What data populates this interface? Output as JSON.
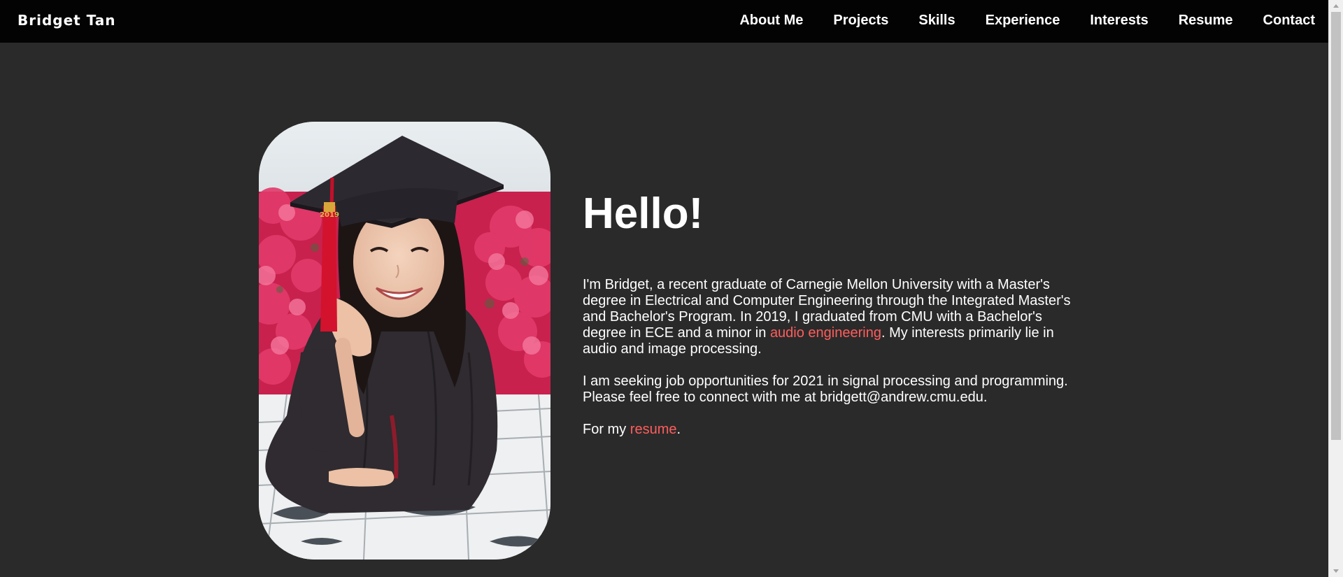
{
  "nav": {
    "brand": "Bridget Tan",
    "links": [
      "About Me",
      "Projects",
      "Skills",
      "Experience",
      "Interests",
      "Resume",
      "Contact"
    ]
  },
  "hero": {
    "heading": "Hello!",
    "intro_part1": "I'm Bridget, a recent graduate of Carnegie Mellon University with a Master's degree in Electrical and Computer Engineering through the Integrated Master's and Bachelor's Program. In 2019, I graduated from CMU with a Bachelor's degree in ECE and a minor in ",
    "intro_link": "audio engineering",
    "intro_part2": ". My interests primarily lie in audio and image processing.",
    "seeking": "I am seeking job opportunities for 2021 in signal processing and programming. Please feel free to connect with me at bridgett@andrew.cmu.edu.",
    "resume_prefix": "For my ",
    "resume_link": "resume",
    "resume_suffix": ".",
    "photo_cap_text": "2019"
  },
  "colors": {
    "background": "#2a2a2a",
    "navbar": "#030303",
    "accent": "#ff5d5d",
    "text": "#ffffff"
  },
  "icons": {
    "scroll_up": "triangle-up-icon",
    "scroll_down": "triangle-down-icon"
  }
}
